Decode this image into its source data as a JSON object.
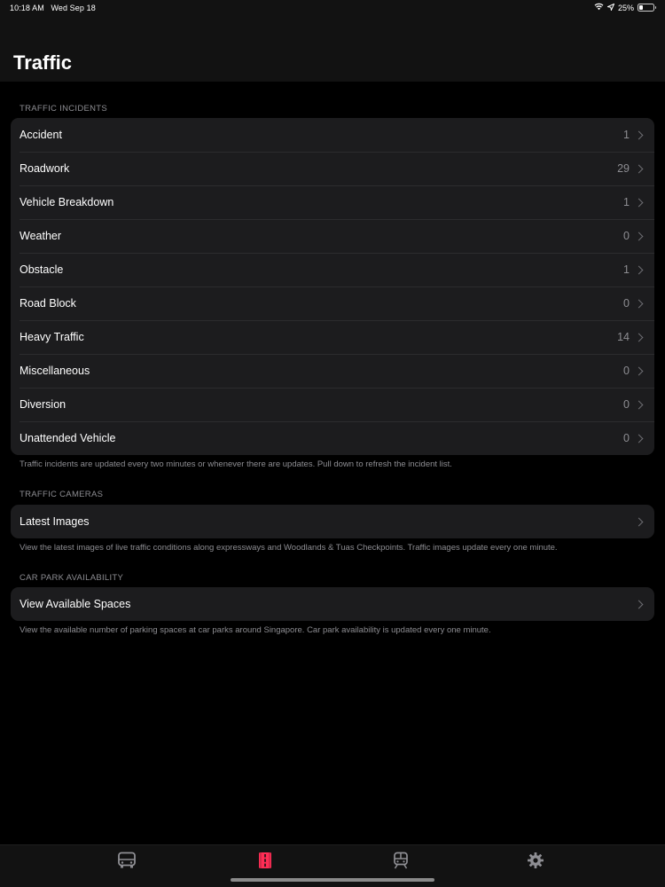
{
  "status_bar": {
    "time": "10:18 AM",
    "date": "Wed Sep 18",
    "battery_percent": "25%",
    "battery_level": 0.25,
    "icons": [
      "wifi-icon",
      "location-arrow-icon",
      "battery-icon"
    ]
  },
  "header": {
    "title": "Traffic"
  },
  "sections": {
    "incidents": {
      "header": "TRAFFIC INCIDENTS",
      "footer": "Traffic incidents are updated every two minutes or whenever there are updates. Pull down to refresh the incident list.",
      "items": [
        {
          "label": "Accident",
          "count": "1"
        },
        {
          "label": "Roadwork",
          "count": "29"
        },
        {
          "label": "Vehicle Breakdown",
          "count": "1"
        },
        {
          "label": "Weather",
          "count": "0"
        },
        {
          "label": "Obstacle",
          "count": "1"
        },
        {
          "label": "Road Block",
          "count": "0"
        },
        {
          "label": "Heavy Traffic",
          "count": "14"
        },
        {
          "label": "Miscellaneous",
          "count": "0"
        },
        {
          "label": "Diversion",
          "count": "0"
        },
        {
          "label": "Unattended Vehicle",
          "count": "0"
        }
      ]
    },
    "cameras": {
      "header": "TRAFFIC CAMERAS",
      "item_label": "Latest Images",
      "footer": "View the latest images of live traffic conditions along expressways and Woodlands & Tuas Checkpoints. Traffic images update every one minute."
    },
    "carpark": {
      "header": "CAR PARK AVAILABILITY",
      "item_label": "View Available Spaces",
      "footer": "View the available number of parking spaces at car parks around Singapore. Car park availability is updated every one minute."
    }
  },
  "tab_bar": {
    "tabs": [
      {
        "icon": "bus-icon",
        "selected": false
      },
      {
        "icon": "road-icon",
        "selected": true
      },
      {
        "icon": "train-icon",
        "selected": false
      },
      {
        "icon": "gear-icon",
        "selected": false
      }
    ],
    "accent_color": "#ff2d55",
    "inactive_color": "#8e8e93"
  },
  "colors": {
    "background": "#000000",
    "cell_background": "#1c1c1e",
    "secondary_text": "#8d8d92"
  }
}
